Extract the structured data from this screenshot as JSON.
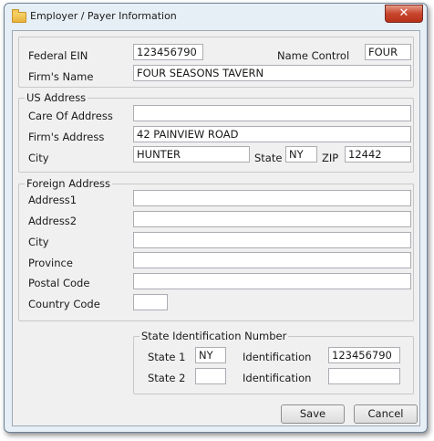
{
  "window": {
    "title": "Employer / Payer Information",
    "close_glyph": "✕"
  },
  "employer": {
    "federal_ein_label": "Federal EIN",
    "federal_ein": "123456790",
    "name_control_label": "Name Control",
    "name_control": "FOUR",
    "firms_name_label": "Firm's Name",
    "firms_name": "FOUR SEASONS TAVERN"
  },
  "us_address": {
    "legend": "US Address",
    "care_of_label": "Care Of Address",
    "care_of": "",
    "firms_address_label": "Firm's Address",
    "firms_address": "42 PAINVIEW ROAD",
    "city_label": "City",
    "city": "HUNTER",
    "state_label": "State",
    "state": "NY",
    "zip_label": "ZIP",
    "zip": "12442"
  },
  "foreign_address": {
    "legend": "Foreign Address",
    "address1_label": "Address1",
    "address1": "",
    "address2_label": "Address2",
    "address2": "",
    "city_label": "City",
    "city": "",
    "province_label": "Province",
    "province": "",
    "postal_code_label": "Postal Code",
    "postal_code": "",
    "country_code_label": "Country Code",
    "country_code": ""
  },
  "state_id": {
    "legend": "State Identification Number",
    "state1_label": "State 1",
    "state1": "NY",
    "identification1_label": "Identification",
    "identification1": "123456790",
    "state2_label": "State 2",
    "state2": "",
    "identification2_label": "Identification",
    "identification2": ""
  },
  "buttons": {
    "save": "Save",
    "cancel": "Cancel"
  }
}
